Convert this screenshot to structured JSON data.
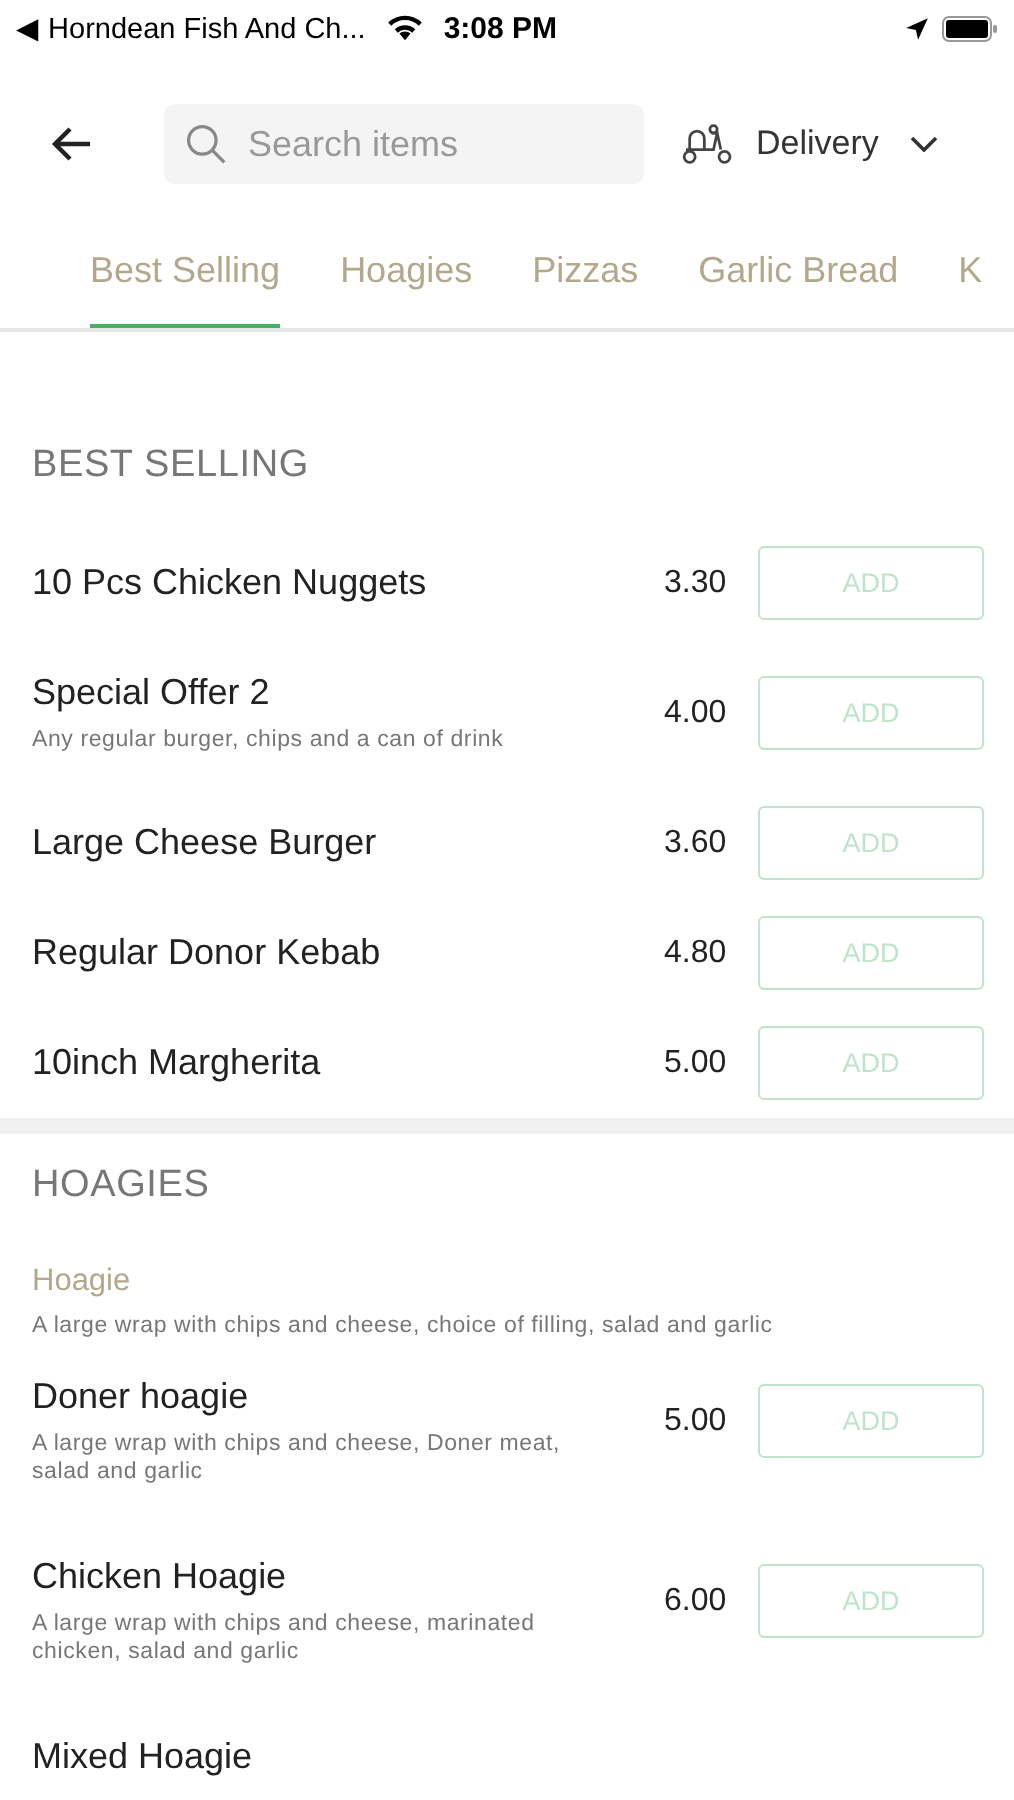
{
  "status_bar": {
    "back_app": "◀ Horndean Fish And Ch...",
    "time": "3:08 PM"
  },
  "header": {
    "search": {
      "placeholder": "Search items"
    },
    "mode": "Delivery"
  },
  "tabs": [
    {
      "label": "Best Selling",
      "selected": true
    },
    {
      "label": "Hoagies",
      "selected": false
    },
    {
      "label": "Pizzas",
      "selected": false
    },
    {
      "label": "Garlic Bread",
      "selected": false
    },
    {
      "label": "K",
      "selected": false
    }
  ],
  "sections": [
    {
      "title": "BEST SELLING",
      "entries": [
        {
          "kind": "item",
          "name": "10 Pcs Chicken Nuggets",
          "price": "3.30",
          "button": "ADD"
        },
        {
          "kind": "item",
          "name": "Special Offer 2",
          "description": "Any regular burger, chips and a can of drink",
          "price": "4.00",
          "button": "ADD"
        },
        {
          "kind": "item",
          "name": "Large Cheese Burger",
          "price": "3.60",
          "button": "ADD"
        },
        {
          "kind": "item",
          "name": "Regular Donor Kebab",
          "price": "4.80",
          "button": "ADD"
        },
        {
          "kind": "item",
          "name": "10inch Margherita",
          "price": "5.00",
          "button": "ADD"
        }
      ]
    },
    {
      "title": "HOAGIES",
      "entries": [
        {
          "kind": "subheading",
          "name": "Hoagie",
          "description": "A large wrap with chips and cheese, choice of filling, salad and garlic"
        },
        {
          "kind": "item",
          "name": "Doner hoagie",
          "description": "A large wrap with chips and cheese, Doner meat, salad and garlic",
          "price": "5.00",
          "button": "ADD"
        },
        {
          "kind": "item",
          "name": "Chicken Hoagie",
          "description": "A large wrap with chips and cheese, marinated chicken, salad and garlic",
          "price": "6.00",
          "button": "ADD"
        },
        {
          "kind": "item",
          "name": "Mixed Hoagie"
        }
      ]
    }
  ]
}
